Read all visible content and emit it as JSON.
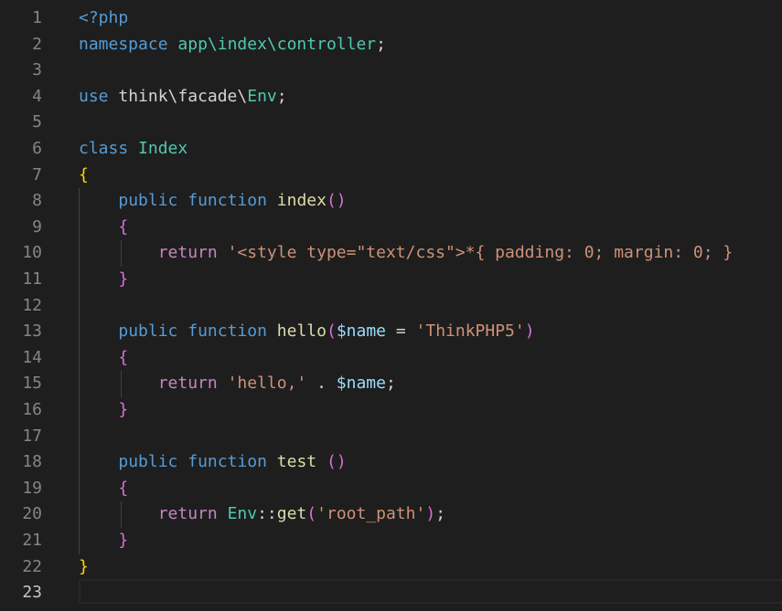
{
  "editor": {
    "language": "php",
    "active_line": 23,
    "colors": {
      "background": "#1e1e1e",
      "keyword": "#569cd6",
      "control": "#c586c0",
      "function": "#dcdcaa",
      "class": "#4ec9b0",
      "variable": "#9cdcfe",
      "string": "#ce9178",
      "text": "#d4d4d4",
      "bracket_level1": "#ffd700",
      "bracket_level2": "#da70d6",
      "line_number": "#858585"
    },
    "lines": [
      {
        "n": "1",
        "tokens": [
          {
            "t": "<?php",
            "c": "kw"
          }
        ]
      },
      {
        "n": "2",
        "tokens": [
          {
            "t": "namespace",
            "c": "kw"
          },
          {
            "t": " ",
            "c": "txt"
          },
          {
            "t": "app\\index\\controller",
            "c": "cls"
          },
          {
            "t": ";",
            "c": "txt"
          }
        ]
      },
      {
        "n": "3",
        "tokens": []
      },
      {
        "n": "4",
        "tokens": [
          {
            "t": "use",
            "c": "kw"
          },
          {
            "t": " think\\facade\\",
            "c": "txt"
          },
          {
            "t": "Env",
            "c": "cls"
          },
          {
            "t": ";",
            "c": "txt"
          }
        ]
      },
      {
        "n": "5",
        "tokens": []
      },
      {
        "n": "6",
        "tokens": [
          {
            "t": "class",
            "c": "kw"
          },
          {
            "t": " ",
            "c": "txt"
          },
          {
            "t": "Index",
            "c": "cls"
          }
        ]
      },
      {
        "n": "7",
        "tokens": [
          {
            "t": "{",
            "c": "br1"
          }
        ]
      },
      {
        "n": "8",
        "tokens": [
          {
            "t": "    ",
            "c": "txt"
          },
          {
            "t": "public",
            "c": "kw"
          },
          {
            "t": " ",
            "c": "txt"
          },
          {
            "t": "function",
            "c": "kw"
          },
          {
            "t": " ",
            "c": "txt"
          },
          {
            "t": "index",
            "c": "fn"
          },
          {
            "t": "()",
            "c": "br2"
          }
        ]
      },
      {
        "n": "9",
        "tokens": [
          {
            "t": "    ",
            "c": "txt"
          },
          {
            "t": "{",
            "c": "br2"
          }
        ]
      },
      {
        "n": "10",
        "tokens": [
          {
            "t": "        ",
            "c": "txt"
          },
          {
            "t": "return",
            "c": "ctrl"
          },
          {
            "t": " ",
            "c": "txt"
          },
          {
            "t": "'<style type=\"text/css\">*{ padding: 0; margin: 0; }",
            "c": "str"
          }
        ]
      },
      {
        "n": "11",
        "tokens": [
          {
            "t": "    ",
            "c": "txt"
          },
          {
            "t": "}",
            "c": "br2"
          }
        ]
      },
      {
        "n": "12",
        "tokens": []
      },
      {
        "n": "13",
        "tokens": [
          {
            "t": "    ",
            "c": "txt"
          },
          {
            "t": "public",
            "c": "kw"
          },
          {
            "t": " ",
            "c": "txt"
          },
          {
            "t": "function",
            "c": "kw"
          },
          {
            "t": " ",
            "c": "txt"
          },
          {
            "t": "hello",
            "c": "fn"
          },
          {
            "t": "(",
            "c": "br2"
          },
          {
            "t": "$name",
            "c": "var"
          },
          {
            "t": " = ",
            "c": "txt"
          },
          {
            "t": "'ThinkPHP5'",
            "c": "str"
          },
          {
            "t": ")",
            "c": "br2"
          }
        ]
      },
      {
        "n": "14",
        "tokens": [
          {
            "t": "    ",
            "c": "txt"
          },
          {
            "t": "{",
            "c": "br2"
          }
        ]
      },
      {
        "n": "15",
        "tokens": [
          {
            "t": "        ",
            "c": "txt"
          },
          {
            "t": "return",
            "c": "ctrl"
          },
          {
            "t": " ",
            "c": "txt"
          },
          {
            "t": "'hello,'",
            "c": "str"
          },
          {
            "t": " . ",
            "c": "txt"
          },
          {
            "t": "$name",
            "c": "var"
          },
          {
            "t": ";",
            "c": "txt"
          }
        ]
      },
      {
        "n": "16",
        "tokens": [
          {
            "t": "    ",
            "c": "txt"
          },
          {
            "t": "}",
            "c": "br2"
          }
        ]
      },
      {
        "n": "17",
        "tokens": []
      },
      {
        "n": "18",
        "tokens": [
          {
            "t": "    ",
            "c": "txt"
          },
          {
            "t": "public",
            "c": "kw"
          },
          {
            "t": " ",
            "c": "txt"
          },
          {
            "t": "function",
            "c": "kw"
          },
          {
            "t": " ",
            "c": "txt"
          },
          {
            "t": "test",
            "c": "fn"
          },
          {
            "t": " ",
            "c": "txt"
          },
          {
            "t": "()",
            "c": "br2"
          }
        ]
      },
      {
        "n": "19",
        "tokens": [
          {
            "t": "    ",
            "c": "txt"
          },
          {
            "t": "{",
            "c": "br2"
          }
        ]
      },
      {
        "n": "20",
        "tokens": [
          {
            "t": "        ",
            "c": "txt"
          },
          {
            "t": "return",
            "c": "ctrl"
          },
          {
            "t": " ",
            "c": "txt"
          },
          {
            "t": "Env",
            "c": "cls"
          },
          {
            "t": "::",
            "c": "txt"
          },
          {
            "t": "get",
            "c": "fn"
          },
          {
            "t": "(",
            "c": "br2"
          },
          {
            "t": "'root_path'",
            "c": "str"
          },
          {
            "t": ")",
            "c": "br2"
          },
          {
            "t": ";",
            "c": "txt"
          }
        ]
      },
      {
        "n": "21",
        "tokens": [
          {
            "t": "    ",
            "c": "txt"
          },
          {
            "t": "}",
            "c": "br2"
          }
        ]
      },
      {
        "n": "22",
        "tokens": [
          {
            "t": "}",
            "c": "br1"
          }
        ]
      },
      {
        "n": "23",
        "tokens": []
      }
    ]
  }
}
